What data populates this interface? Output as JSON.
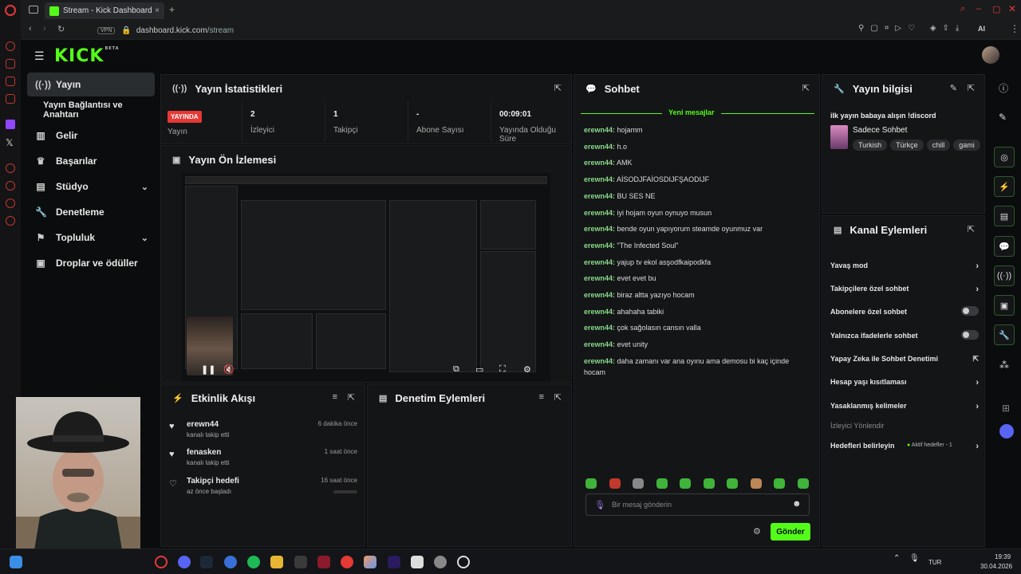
{
  "browser": {
    "tab_title": "Stream - Kick Dashboard",
    "new_tab": "+",
    "url_domain": "dashboard.kick.com",
    "url_path": "/stream",
    "vpn_label": "VPN",
    "ai_label": "AI"
  },
  "app": {
    "logo": "KICK",
    "beta": "BETA"
  },
  "sidebar": {
    "items": [
      {
        "label": "Yayın",
        "icon": "broadcast-icon"
      },
      {
        "label": "Yayın Bağlantısı ve Anahtarı",
        "icon": ""
      },
      {
        "label": "Gelir",
        "icon": "chart-icon"
      },
      {
        "label": "Başarılar",
        "icon": "trophy-icon"
      },
      {
        "label": "Stüdyo",
        "icon": "studio-icon"
      },
      {
        "label": "Denetleme",
        "icon": "wrench-icon"
      },
      {
        "label": "Topluluk",
        "icon": "community-icon"
      },
      {
        "label": "Droplar ve ödüller",
        "icon": "drops-icon"
      }
    ]
  },
  "stats": {
    "title": "Yayın İstatistikleri",
    "live_badge": "YAYINDA",
    "live_label": "Yayın",
    "viewers_value": "2",
    "viewers_label": "İzleyici",
    "followers_value": "1",
    "followers_label": "Takipçi",
    "subs_value": "-",
    "subs_label": "Abone Sayısı",
    "uptime_value": "00:09:01",
    "uptime_label": "Yayında Olduğu Süre"
  },
  "preview": {
    "title": "Yayın Ön İzlemesi"
  },
  "activity": {
    "title": "Etkinlik Akışı",
    "events": [
      {
        "name": "erewn44",
        "sub": "kanalı takip etti",
        "time": "6 dakika önce"
      },
      {
        "name": "fenasken",
        "sub": "kanalı takip etti",
        "time": "1 saat önce"
      },
      {
        "name": "Takipçi hedefi",
        "sub": "az önce başladı",
        "time": "16 saat önce"
      }
    ]
  },
  "moderation": {
    "title": "Denetim Eylemleri"
  },
  "chat": {
    "title": "Sohbet",
    "new_messages": "Yeni mesajlar",
    "messages": [
      {
        "user": "erewn44:",
        "text": "hojamm"
      },
      {
        "user": "erewn44:",
        "text": "h.o"
      },
      {
        "user": "erewn44:",
        "text": "AMK"
      },
      {
        "user": "erewn44:",
        "text": "AİSODJFAİOSDIJFŞAODIJF"
      },
      {
        "user": "erewn44:",
        "text": "BU SES NE"
      },
      {
        "user": "erewn44:",
        "text": "iyi hojam oyun oynuyo musun"
      },
      {
        "user": "erewn44:",
        "text": "bende oyun yapıyorum steamde oyunmuz var"
      },
      {
        "user": "erewn44:",
        "text": "\"The Infected Soul\""
      },
      {
        "user": "erewn44:",
        "text": "yajup tv ekol asşodfkaipodkfa"
      },
      {
        "user": "erewn44:",
        "text": "evet evet bu"
      },
      {
        "user": "erewn44:",
        "text": "biraz altta yazıyo hocam"
      },
      {
        "user": "erewn44:",
        "text": "ahahaha tabiki"
      },
      {
        "user": "erewn44:",
        "text": "çok sağolasın cansın valla"
      },
      {
        "user": "erewn44:",
        "text": "evet unity"
      },
      {
        "user": "erewn44:",
        "text": "daha zamanı var ana oyınu ama demosu bi kaç içinde hocam"
      }
    ],
    "placeholder": "Bir mesaj gönderin",
    "send": "Gönder"
  },
  "stream_info": {
    "title": "Yayın bilgisi",
    "stream_title": "ilk yayın babaya alışın !discord",
    "category": "Sadece Sohbet",
    "tags": [
      "Turkish",
      "Türkçe",
      "chill",
      "gami"
    ]
  },
  "channel_actions": {
    "title": "Kanal Eylemleri",
    "rows": [
      {
        "label": "Yavaş mod",
        "control": "chevron"
      },
      {
        "label": "Takipçilere özel sohbet",
        "control": "chevron"
      },
      {
        "label": "Abonelere özel sohbet",
        "control": "toggle"
      },
      {
        "label": "Yalnızca ifadelerle sohbet",
        "control": "toggle"
      },
      {
        "label": "Yapay Zeka ile Sohbet Denetimi",
        "control": "external"
      },
      {
        "label": "Hesap yaşı kısıtlaması",
        "control": "chevron"
      },
      {
        "label": "Yasaklanmış kelimeler",
        "control": "chevron"
      }
    ],
    "section_label": "İzleyici Yönlendir",
    "goals_label": "Hedefleri belirleyin",
    "goals_status": "Aktif hedefler - 1"
  },
  "taskbar": {
    "lang": "TUR",
    "time": "19:39",
    "date": "30.04.2026"
  },
  "colors": {
    "accent": "#53fc18",
    "live": "#e53935",
    "background": "#0b0c0d",
    "panel": "#141517"
  }
}
